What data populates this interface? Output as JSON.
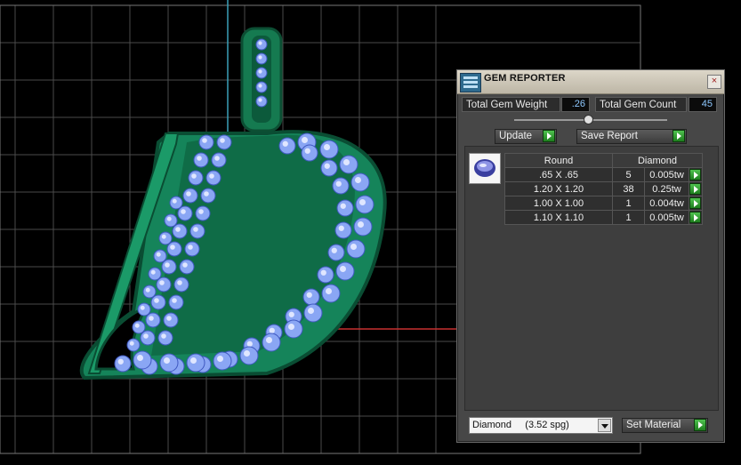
{
  "viewport": {
    "grid_color": "#4a4a4a",
    "model_color": "#1f8f60",
    "gem_color": "#8aa6f4"
  },
  "gem_reporter": {
    "title": "GEM REPORTER",
    "close_symbol": "×",
    "total_weight_label": "Total Gem Weight",
    "total_weight_value": ".26",
    "total_count_label": "Total Gem Count",
    "total_count_value": "45",
    "update_label": "Update",
    "save_report_label": "Save Report",
    "gem_icon": "round-gem-icon",
    "table": {
      "shape_header": "Round",
      "material_header": "Diamond",
      "rows": [
        {
          "size": ".65 X .65",
          "count": "5",
          "weight": "0.005tw"
        },
        {
          "size": "1.20 X 1.20",
          "count": "38",
          "weight": "0.25tw"
        },
        {
          "size": "1.00 X 1.00",
          "count": "1",
          "weight": "0.004tw"
        },
        {
          "size": "1.10 X 1.10",
          "count": "1",
          "weight": "0.005tw"
        }
      ]
    },
    "material_select_value": "Diamond     (3.52 spg)",
    "set_material_label": "Set Material"
  }
}
